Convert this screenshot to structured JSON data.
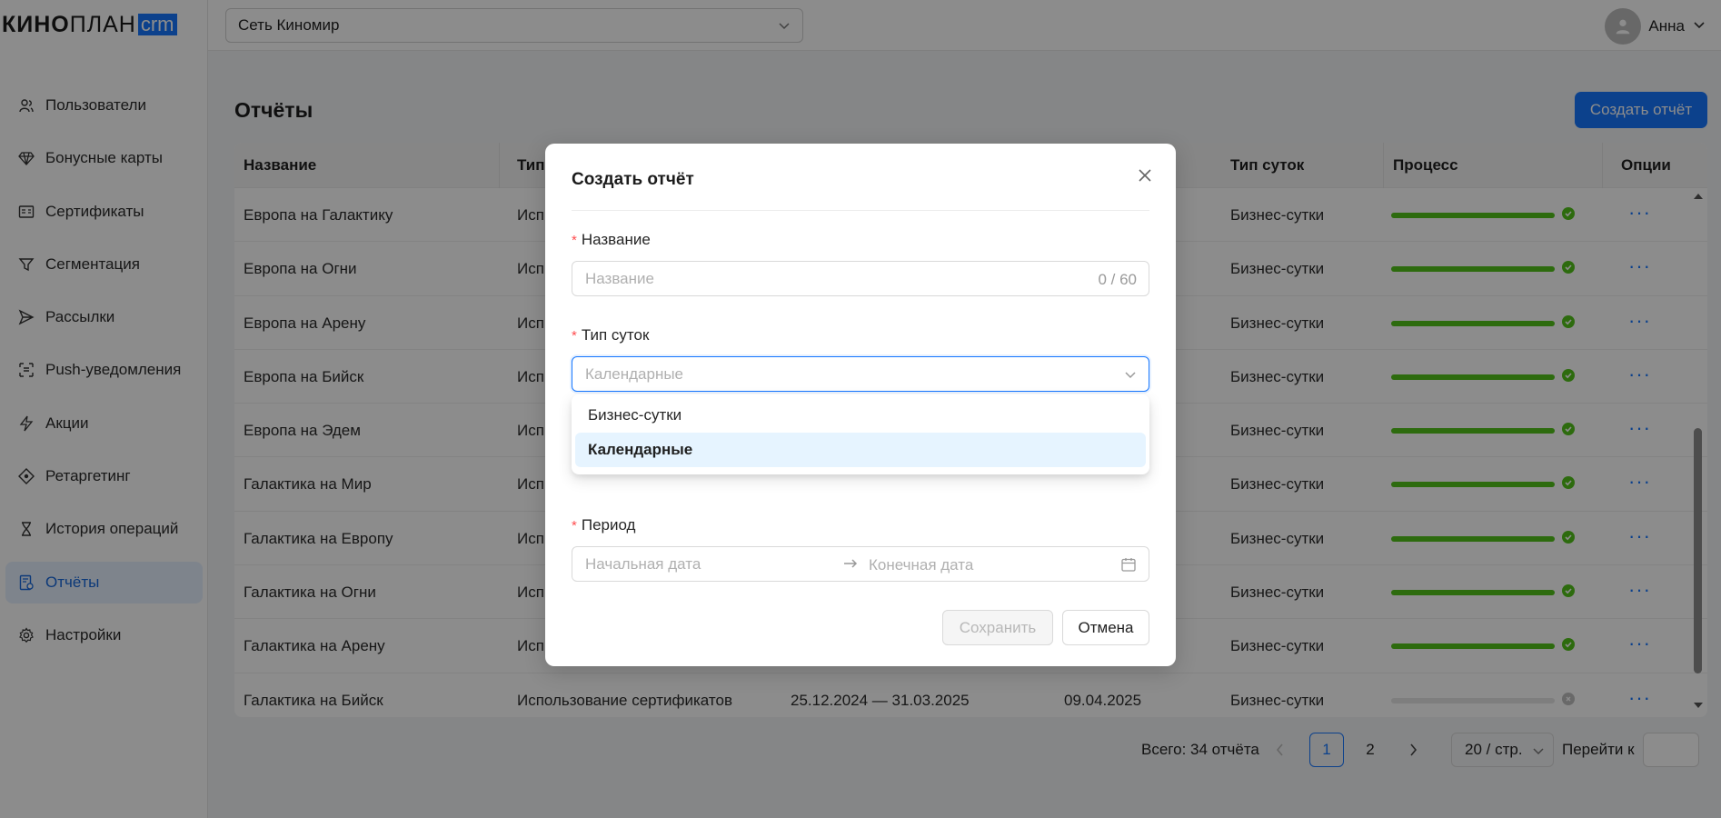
{
  "logo": {
    "part1": "КИНО",
    "part2": "ПЛАН",
    "part3": "crm"
  },
  "sidebar": {
    "items": [
      {
        "label": "Пользователи",
        "icon": "users-icon"
      },
      {
        "label": "Бонусные карты",
        "icon": "diamond-icon"
      },
      {
        "label": "Сертификаты",
        "icon": "certificate-icon"
      },
      {
        "label": "Сегментация",
        "icon": "filter-icon"
      },
      {
        "label": "Рассылки",
        "icon": "send-icon"
      },
      {
        "label": "Push-уведомления",
        "icon": "push-icon"
      },
      {
        "label": "Акции",
        "icon": "lightning-icon"
      },
      {
        "label": "Ретаргетинг",
        "icon": "target-icon"
      },
      {
        "label": "История операций",
        "icon": "hourglass-icon"
      },
      {
        "label": "Отчёты",
        "icon": "report-icon",
        "active": true
      },
      {
        "label": "Настройки",
        "icon": "gear-icon"
      }
    ]
  },
  "header": {
    "network": "Сеть Киномир",
    "user_name": "Анна"
  },
  "page": {
    "title": "Отчёты",
    "create_button": "Создать отчёт"
  },
  "table": {
    "columns": [
      "Название",
      "Тип",
      "Тип суток",
      "Процесс",
      "Опции"
    ],
    "rows": [
      {
        "name": "Европа на Галактику",
        "type": "Исп",
        "period": "",
        "date": "",
        "day_type": "Бизнес-сутки",
        "progress": 1.0,
        "status": "done"
      },
      {
        "name": "Европа на Огни",
        "type": "Исп",
        "period": "",
        "date": "",
        "day_type": "Бизнес-сутки",
        "progress": 1.0,
        "status": "done"
      },
      {
        "name": "Европа на Арену",
        "type": "Исп",
        "period": "",
        "date": "",
        "day_type": "Бизнес-сутки",
        "progress": 1.0,
        "status": "done"
      },
      {
        "name": "Европа на Бийск",
        "type": "Исп",
        "period": "",
        "date": "",
        "day_type": "Бизнес-сутки",
        "progress": 1.0,
        "status": "done"
      },
      {
        "name": "Европа на Эдем",
        "type": "Исп",
        "period": "",
        "date": "",
        "day_type": "Бизнес-сутки",
        "progress": 1.0,
        "status": "done"
      },
      {
        "name": "Галактика на Мир",
        "type": "Исп",
        "period": "",
        "date": "",
        "day_type": "Бизнес-сутки",
        "progress": 1.0,
        "status": "done"
      },
      {
        "name": "Галактика на Европу",
        "type": "Исп",
        "period": "",
        "date": "",
        "day_type": "Бизнес-сутки",
        "progress": 1.0,
        "status": "done"
      },
      {
        "name": "Галактика на Огни",
        "type": "Исп",
        "period": "",
        "date": "",
        "day_type": "Бизнес-сутки",
        "progress": 1.0,
        "status": "done"
      },
      {
        "name": "Галактика на Арену",
        "type": "Исп",
        "period": "",
        "date": "",
        "day_type": "Бизнес-сутки",
        "progress": 1.0,
        "status": "done"
      },
      {
        "name": "Галактика на Бийск",
        "type": "Использование сертификатов",
        "period": "25.12.2024 — 31.03.2025",
        "date": "09.04.2025",
        "day_type": "Бизнес-сутки",
        "progress": 0.0,
        "status": "idle"
      }
    ]
  },
  "pagination": {
    "total": "Всего: 34 отчёта",
    "pages": [
      "1",
      "2"
    ],
    "active_page": "1",
    "page_size": "20 / стр.",
    "goto_label": "Перейти к"
  },
  "modal": {
    "title": "Создать отчёт",
    "name_label": "Название",
    "name_placeholder": "Название",
    "name_counter": "0 / 60",
    "day_type_label": "Тип суток",
    "day_type_placeholder": "Календарные",
    "day_type_options": [
      "Бизнес-сутки",
      "Календарные"
    ],
    "day_type_selected": "Календарные",
    "period_label": "Период",
    "start_placeholder": "Начальная дата",
    "end_placeholder": "Конечная дата",
    "save_button": "Сохранить",
    "cancel_button": "Отмена"
  },
  "colors": {
    "primary": "#1677ff",
    "success": "#52c41a",
    "required": "#ff4d4f"
  }
}
